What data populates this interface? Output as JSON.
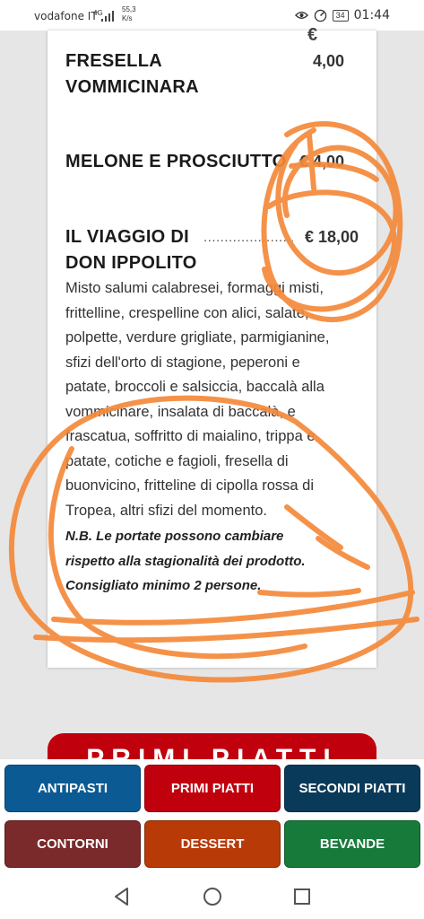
{
  "status_bar": {
    "carrier": "vodafone IT",
    "network": "4G",
    "speed_value": "55,3",
    "speed_unit": "K/s",
    "battery": "34",
    "time": "01:44"
  },
  "menu": {
    "top_currency": "€",
    "items": [
      {
        "name_lines": [
          "FRESELLA",
          "VOMMICINARA"
        ],
        "dots": "",
        "price": "4,00"
      },
      {
        "name_lines": [
          "MELONE E PROSCIUTTO"
        ],
        "dots": "......",
        "price": "€ 4,00"
      },
      {
        "name_lines": [
          "IL VIAGGIO DI",
          "DON IPPOLITO"
        ],
        "dots": "............................",
        "price": "€ 18,00"
      }
    ],
    "description_lines": [
      "Misto salumi calabresei, formaggi misti,",
      "frittelline, crespelline con alici, salate,",
      "polpette, verdure grigliate, parmigianine,",
      "sfizi dell'orto di stagione, peperoni e",
      "patate, broccoli e salsiccia, baccalà alla",
      "vommicinare, insalata di baccalà, e",
      "frascatua, soffritto di maialino, trippa e",
      "patate, cotiche e fagioli, fresella di",
      "buonvicino, fritteline di cipolla rossa di",
      "Tropea, altri sfizi del momento."
    ],
    "note_lines": [
      "N.B. Le portate possono cambiare",
      "rispetto alla stagionalità dei prodotto.",
      "Consigliato minimo 2 persone."
    ]
  },
  "section_header": "PRIMI PIATTI",
  "categories": [
    {
      "label": "ANTIPASTI",
      "color": "#0b5a94"
    },
    {
      "label": "PRIMI PIATTI",
      "color": "#c0000c"
    },
    {
      "label": "SECONDI PIATTI",
      "color": "#0a3a5a"
    },
    {
      "label": "CONTORNI",
      "color": "#7a2a2a"
    },
    {
      "label": "DESSERT",
      "color": "#b83a06"
    },
    {
      "label": "BEVANDE",
      "color": "#177a3a"
    }
  ],
  "scribble_color": "#f5893a",
  "icons": {
    "back": "back-triangle-icon",
    "home": "home-circle-icon",
    "recents": "recents-square-icon"
  }
}
